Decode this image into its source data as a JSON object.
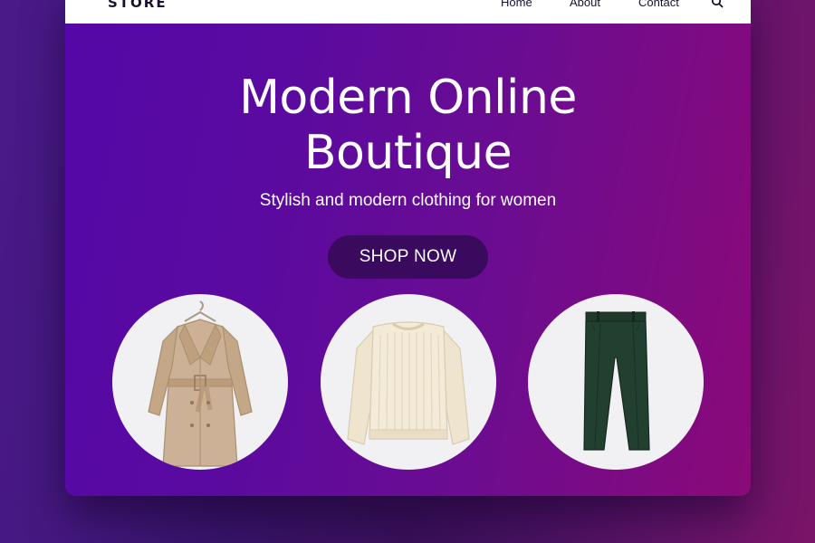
{
  "nav": {
    "logo": "STORE",
    "links": [
      "Home",
      "About",
      "Contact"
    ],
    "search_icon": "search-icon"
  },
  "hero": {
    "title_line1": "Modern Online",
    "title_line2": "Boutique",
    "subtitle": "Stylish and modern clothing for women",
    "cta_label": "SHOP NOW"
  },
  "products": [
    {
      "icon": "trench-coat-image",
      "color": "#cdb196"
    },
    {
      "icon": "knit-sweater-image",
      "color": "#f3ead7"
    },
    {
      "icon": "trousers-image",
      "color": "#22402f"
    }
  ],
  "colors": {
    "accent_button": "#3a0a5e",
    "hero_gradient_start": "#5508a8",
    "hero_gradient_end": "#8a0a78",
    "navbar": "#ffffff"
  }
}
